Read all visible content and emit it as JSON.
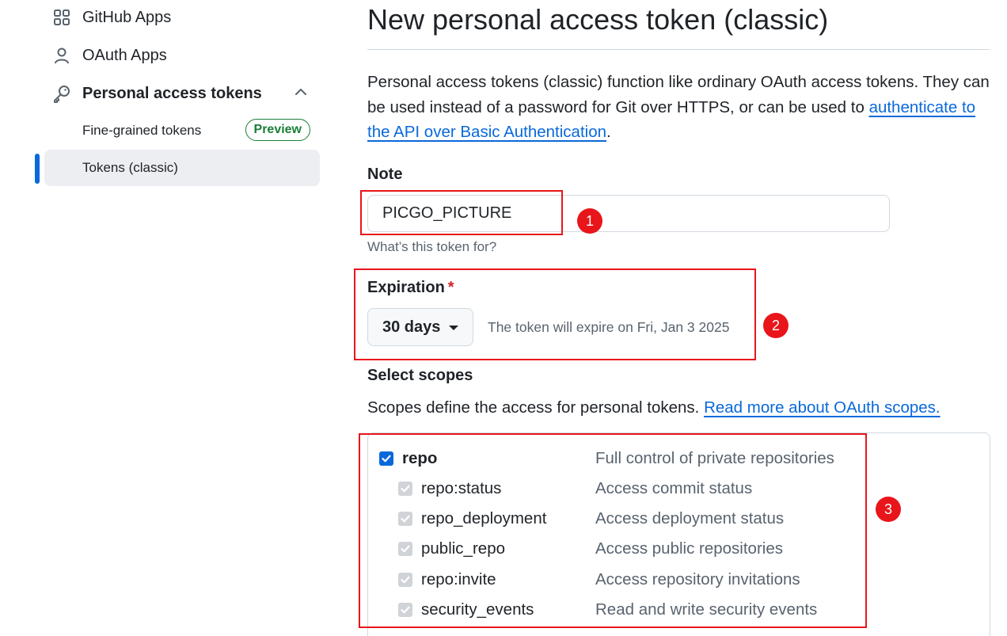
{
  "sidebar": {
    "items": [
      {
        "label": "GitHub Apps",
        "icon": "apps-grid-icon"
      },
      {
        "label": "OAuth Apps",
        "icon": "person-icon"
      },
      {
        "label": "Personal access tokens",
        "icon": "key-icon",
        "expanded": true
      }
    ],
    "sub_items": [
      {
        "label": "Fine-grained tokens",
        "badge": "Preview"
      },
      {
        "label": "Tokens (classic)",
        "active": true
      }
    ]
  },
  "main": {
    "title": "New personal access token (classic)",
    "intro_text": "Personal access tokens (classic) function like ordinary OAuth access tokens. They can be used instead of a password for Git over HTTPS, or can be used to ",
    "intro_link": "authenticate to the API over Basic Authentication",
    "intro_end": ".",
    "note": {
      "label": "Note",
      "value": "PICGO_PICTURE",
      "hint": "What’s this token for?"
    },
    "expiration": {
      "label": "Expiration",
      "required_mark": "*",
      "selected": "30 days",
      "expire_text": "The token will expire on Fri, Jan 3 2025"
    },
    "scopes": {
      "label": "Select scopes",
      "description": "Scopes define the access for personal tokens. ",
      "link": "Read more about OAuth scopes.",
      "items": [
        {
          "name": "repo",
          "desc": "Full control of private repositories",
          "checked": true,
          "parent": true
        },
        {
          "name": "repo:status",
          "desc": "Access commit status",
          "checked": true,
          "disabled": true
        },
        {
          "name": "repo_deployment",
          "desc": "Access deployment status",
          "checked": true,
          "disabled": true
        },
        {
          "name": "public_repo",
          "desc": "Access public repositories",
          "checked": true,
          "disabled": true
        },
        {
          "name": "repo:invite",
          "desc": "Access repository invitations",
          "checked": true,
          "disabled": true
        },
        {
          "name": "security_events",
          "desc": "Read and write security events",
          "checked": true,
          "disabled": true
        }
      ]
    }
  },
  "annotations": [
    "1",
    "2",
    "3"
  ],
  "colors": {
    "accent": "#0969da",
    "annotation": "#e8151b",
    "preview_badge": "#1a7f37",
    "required": "#cf222e"
  }
}
